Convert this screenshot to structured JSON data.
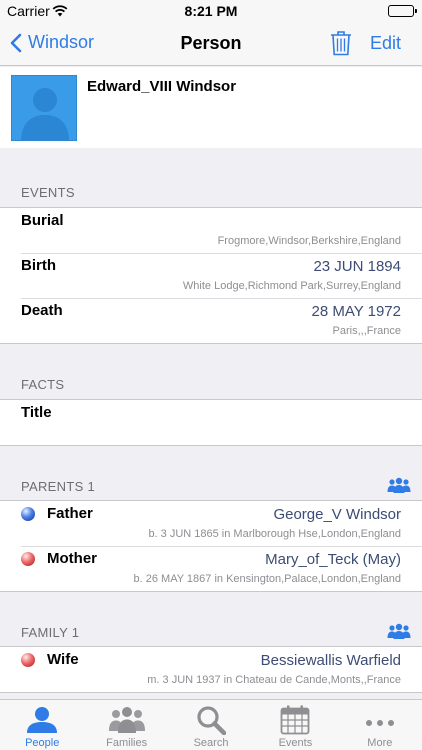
{
  "status_bar": {
    "carrier": "Carrier",
    "time": "8:21 PM"
  },
  "nav": {
    "back_label": "Windsor",
    "title": "Person",
    "edit_label": "Edit"
  },
  "person": {
    "name": "Edward_VIII  Windsor"
  },
  "events": {
    "header": "EVENTS",
    "rows": [
      {
        "label": "Burial",
        "value": "",
        "sub": "Frogmore,Windsor,Berkshire,England"
      },
      {
        "label": "Birth",
        "value": "23 JUN 1894",
        "sub": "White Lodge,Richmond Park,Surrey,England"
      },
      {
        "label": "Death",
        "value": "28 MAY 1972",
        "sub": "Paris,,,France"
      }
    ]
  },
  "facts": {
    "header": "FACTS",
    "rows": [
      {
        "label": "Title"
      }
    ]
  },
  "parents": {
    "header": "PARENTS 1",
    "rows": [
      {
        "label": "Father",
        "value": "George_V  Windsor",
        "sub": "b.  3 JUN 1865 in Marlborough Hse,London,England",
        "dot": "blue"
      },
      {
        "label": "Mother",
        "value": "Mary_of_Teck (May)",
        "sub": "b.  26 MAY 1867 in Kensington,Palace,London,England",
        "dot": "red"
      }
    ]
  },
  "family": {
    "header": "FAMILY 1",
    "rows": [
      {
        "label": "Wife",
        "value": "Bessiewallis  Warfield",
        "sub": "m.  3 JUN 1937 in Chateau de Cande,Monts,,France",
        "dot": "red"
      }
    ]
  },
  "tabs": [
    {
      "label": "People",
      "icon": "person-icon",
      "active": true
    },
    {
      "label": "Families",
      "icon": "families-icon"
    },
    {
      "label": "Search",
      "icon": "search-icon"
    },
    {
      "label": "Events",
      "icon": "calendar-icon"
    },
    {
      "label": "More",
      "icon": "more-icon"
    }
  ],
  "colors": {
    "accent": "#2f7ce6",
    "value_text": "#3d4c74",
    "avatar": "#3a9be8",
    "background": "#efeff4"
  }
}
